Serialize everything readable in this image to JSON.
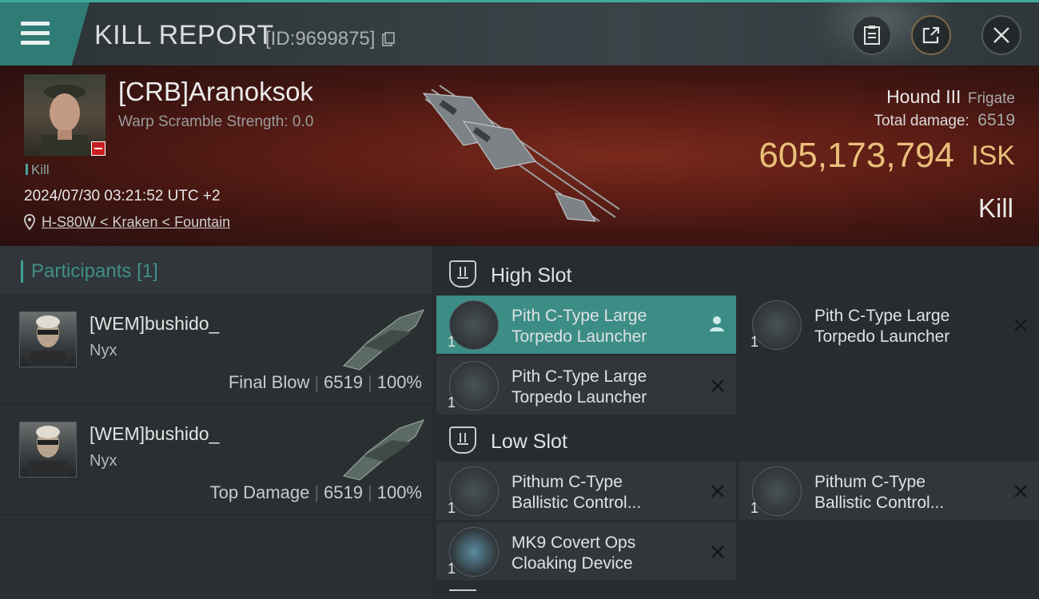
{
  "header": {
    "title": "KILL REPORT",
    "report_id": "[ID:9699875]"
  },
  "victim": {
    "name": "[CRB]Aranoksok",
    "warp_scramble": "Warp Scramble Strength: 0.0",
    "tag": "Kill",
    "datetime": "2024/07/30 03:21:52 UTC +2",
    "location": "H-S80W < Kraken < Fountain",
    "ship_name": "Hound III",
    "ship_class": "Frigate",
    "total_damage_label": "Total damage:",
    "total_damage": "6519",
    "isk_value": "605,173,794",
    "isk_unit": "ISK",
    "result": "Kill"
  },
  "participants": {
    "title": "Participants",
    "count": "[1]",
    "rows": [
      {
        "name": "[WEM]bushido_",
        "ship": "Nyx",
        "role": "Final Blow",
        "damage": "6519",
        "percent": "100%"
      },
      {
        "name": "[WEM]bushido_",
        "ship": "Nyx",
        "role": "Top Damage",
        "damage": "6519",
        "percent": "100%"
      }
    ]
  },
  "slots": {
    "high": {
      "title": "High Slot",
      "modules": [
        {
          "qty": "1",
          "line1": "Pith C-Type Large",
          "line2": "Torpedo Launcher"
        },
        {
          "qty": "1",
          "line1": "Pith C-Type Large",
          "line2": "Torpedo Launcher"
        },
        {
          "qty": "1",
          "line1": "Pith C-Type Large",
          "line2": "Torpedo Launcher"
        }
      ]
    },
    "low": {
      "title": "Low Slot",
      "modules": [
        {
          "qty": "1",
          "line1": "Pithum C-Type",
          "line2": "Ballistic Control..."
        },
        {
          "qty": "1",
          "line1": "Pithum C-Type",
          "line2": "Ballistic Control..."
        },
        {
          "qty": "1",
          "line1": "MK9 Covert Ops",
          "line2": "Cloaking Device"
        }
      ]
    }
  },
  "icons": {
    "menu": "menu-icon",
    "copy": "copy-icon",
    "clipboard": "clipboard-icon",
    "share": "share-icon",
    "close": "close-icon",
    "location": "location-pin-icon"
  },
  "colors": {
    "accent": "#3c8d86",
    "isk": "#e9c07a",
    "banner": "#5c1d15"
  }
}
